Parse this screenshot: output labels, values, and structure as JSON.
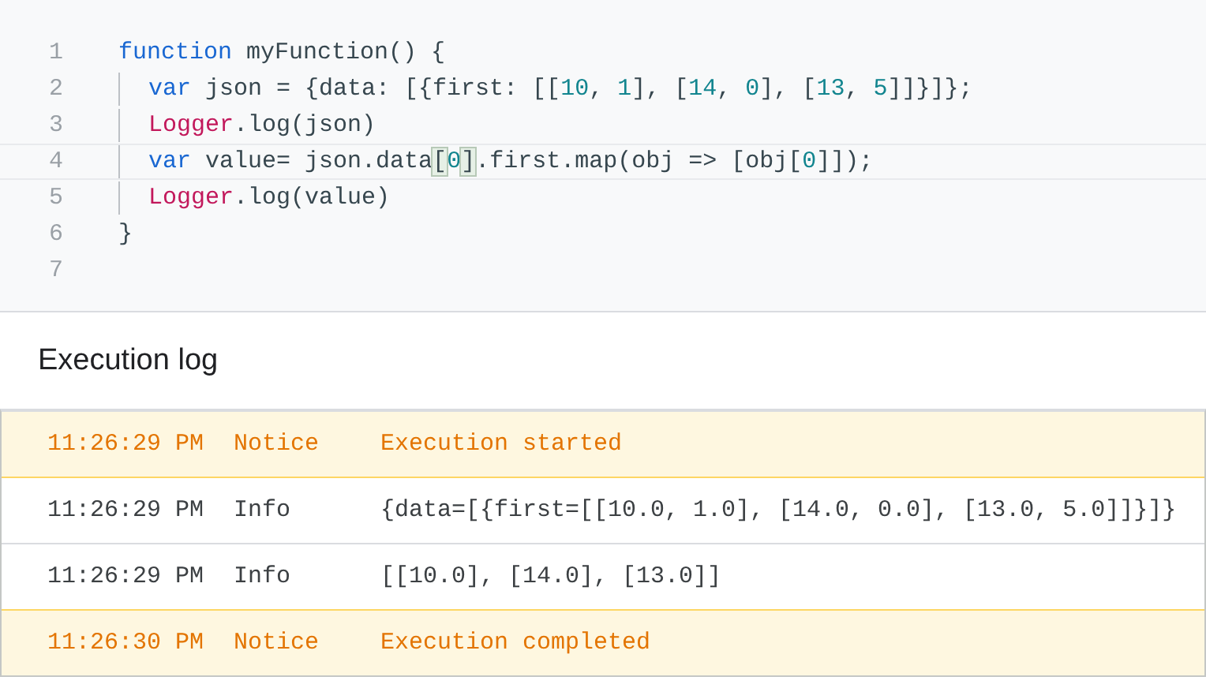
{
  "editor": {
    "lines": [
      {
        "number": "1",
        "indented": false,
        "current": false,
        "tokens": [
          {
            "text": "function",
            "kind": "keyword"
          },
          {
            "text": " myFunction() {",
            "kind": "plain"
          }
        ]
      },
      {
        "number": "2",
        "indented": true,
        "current": false,
        "tokens": [
          {
            "text": "var",
            "kind": "keyword"
          },
          {
            "text": " json = {data: [{first: [[",
            "kind": "plain"
          },
          {
            "text": "10",
            "kind": "number"
          },
          {
            "text": ", ",
            "kind": "plain"
          },
          {
            "text": "1",
            "kind": "number"
          },
          {
            "text": "], [",
            "kind": "plain"
          },
          {
            "text": "14",
            "kind": "number"
          },
          {
            "text": ", ",
            "kind": "plain"
          },
          {
            "text": "0",
            "kind": "number"
          },
          {
            "text": "], [",
            "kind": "plain"
          },
          {
            "text": "13",
            "kind": "number"
          },
          {
            "text": ", ",
            "kind": "plain"
          },
          {
            "text": "5",
            "kind": "number"
          },
          {
            "text": "]]}]};",
            "kind": "plain"
          }
        ]
      },
      {
        "number": "3",
        "indented": true,
        "current": false,
        "tokens": [
          {
            "text": "Logger",
            "kind": "builtin"
          },
          {
            "text": ".log(json)",
            "kind": "plain"
          }
        ]
      },
      {
        "number": "4",
        "indented": true,
        "current": true,
        "tokens": [
          {
            "text": "var",
            "kind": "keyword"
          },
          {
            "text": " value= json.data",
            "kind": "plain"
          },
          {
            "text": "[",
            "kind": "match"
          },
          {
            "text": "0",
            "kind": "number"
          },
          {
            "text": "]",
            "kind": "match"
          },
          {
            "text": ".first.map(obj => [obj[",
            "kind": "plain"
          },
          {
            "text": "0",
            "kind": "number"
          },
          {
            "text": "]]);",
            "kind": "plain"
          }
        ]
      },
      {
        "number": "5",
        "indented": true,
        "current": false,
        "tokens": [
          {
            "text": "Logger",
            "kind": "builtin"
          },
          {
            "text": ".log(value)",
            "kind": "plain"
          }
        ]
      },
      {
        "number": "6",
        "indented": false,
        "current": false,
        "tokens": [
          {
            "text": "}",
            "kind": "plain"
          }
        ]
      },
      {
        "number": "7",
        "indented": false,
        "current": false
      }
    ]
  },
  "execution_log": {
    "title": "Execution log",
    "rows": [
      {
        "time": "11:26:29 PM",
        "level": "Notice",
        "message": "Execution started",
        "kind": "notice"
      },
      {
        "time": "11:26:29 PM",
        "level": "Info",
        "message": "{data=[{first=[[10.0, 1.0], [14.0, 0.0], [13.0, 5.0]]}]}",
        "kind": "info"
      },
      {
        "time": "11:26:29 PM",
        "level": "Info",
        "message": "[[10.0], [14.0], [13.0]]",
        "kind": "info"
      },
      {
        "time": "11:26:30 PM",
        "level": "Notice",
        "message": "Execution completed",
        "kind": "notice"
      }
    ]
  }
}
